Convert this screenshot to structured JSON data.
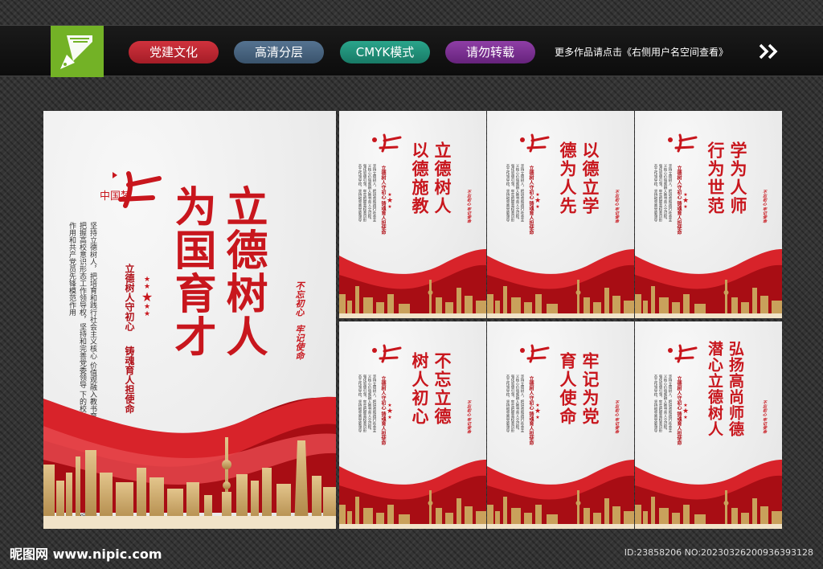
{
  "banner": {
    "tags": [
      "党建文化",
      "高清分层",
      "CMYK模式",
      "请勿转载"
    ],
    "hint": "更多作品请点击《右侧用户名空间查看》",
    "colors": {
      "logo": "#73b226",
      "tag1": "#c0262f",
      "tag2": "#4a6580",
      "tag3": "#209480",
      "tag4": "#7a2f92"
    }
  },
  "main_poster": {
    "emblem_text": "中国梦",
    "title_lines": [
      "立德树人",
      "为国育才"
    ],
    "mid_lines": [
      "立德树人守初心",
      "铸魂育人担使命"
    ],
    "body_lines": [
      "坚持立德树人，把培育和践行社会主义核心",
      "价值观融入教书育人全过程，强化思想引领，牢牢",
      "把握高校意识形态工作领导权，坚持和完善党委领导",
      "下的校长负责制，充分发挥党组织战斗堡垒",
      "作用和共产党员先锋模范作用"
    ],
    "motto_lines": [
      "不忘初心",
      "牢记使命"
    ]
  },
  "small_posters": [
    {
      "title_lines": [
        "立德树人",
        "以德施教"
      ]
    },
    {
      "title_lines": [
        "以德立学",
        "德为人先"
      ]
    },
    {
      "title_lines": [
        "学为人师",
        "行为世范"
      ]
    },
    {
      "title_lines": [
        "不忘立德",
        "树人初心"
      ]
    },
    {
      "title_lines": [
        "牢记为党",
        "育人使命"
      ]
    },
    {
      "title_lines": [
        "弘扬高尚师德",
        "潜心立德树人"
      ]
    }
  ],
  "small_common": {
    "mid_lines": [
      "立德树人守初心",
      "铸魂育人担使命"
    ],
    "motto_lines": [
      "不忘初心",
      "牢记使命"
    ]
  },
  "footer": {
    "watermark": "昵图网 www.nipic.com",
    "id_line": "ID:23858206 NO:20230326200936393128"
  },
  "theme": {
    "accent": "#c8161d",
    "gold": "#c9a15b"
  }
}
